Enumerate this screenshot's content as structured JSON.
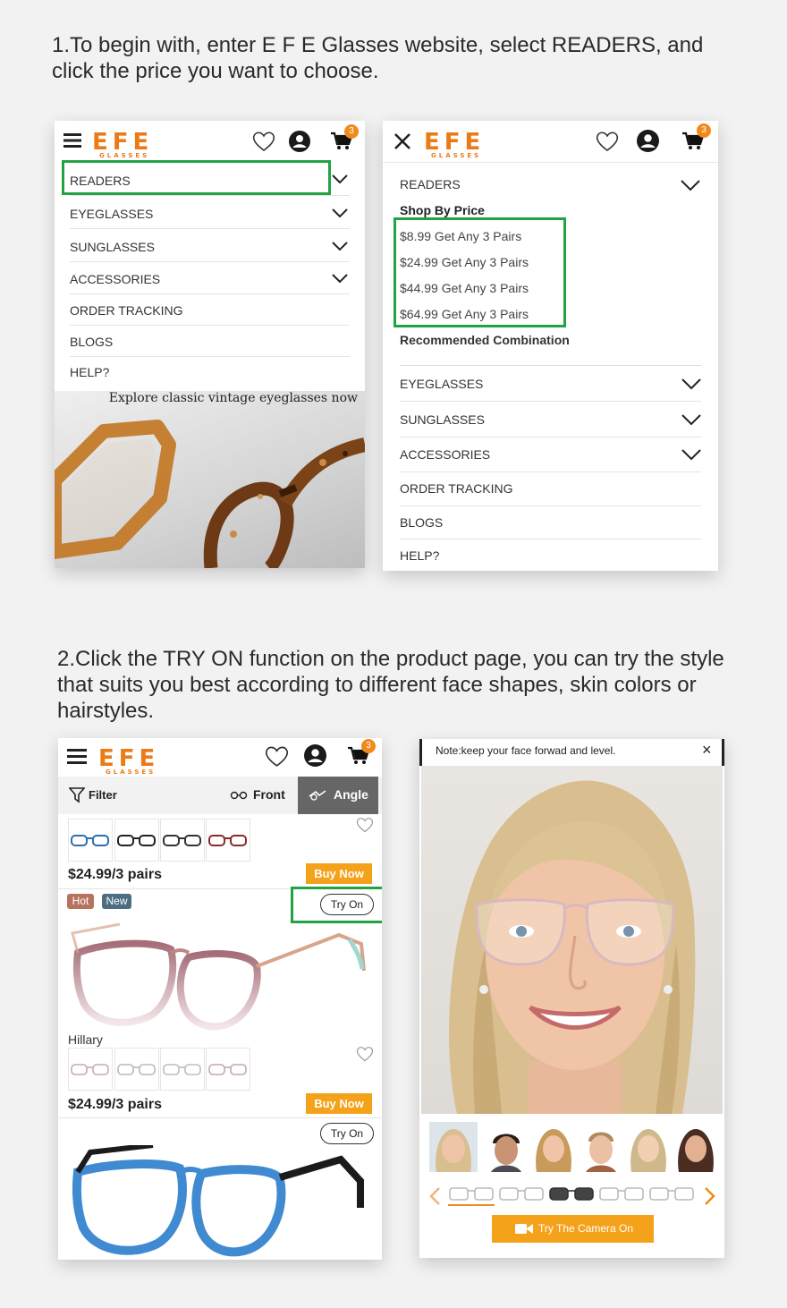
{
  "steps": {
    "step1": "1.To begin with, enter E F E Glasses website, select READERS, and\nclick the price you want to choose.",
    "step2": "2.Click the TRY ON function on the product page, you can try the style\nthat suits you best according to different face shapes, skin colors or\nhairstyles."
  },
  "brand": {
    "logo": "EFE",
    "tagline": "GLASSES",
    "accent": "#ec7a16",
    "highlight": "#22a342"
  },
  "cart_count": "3",
  "panel1": {
    "menu": [
      "READERS",
      "EYEGLASSES",
      "SUNGLASSES",
      "ACCESSORIES",
      "ORDER TRACKING",
      "BLOGS",
      "HELP?"
    ],
    "banner_text": "Explore classic vintage eyeglasses now"
  },
  "panel2": {
    "readers": "READERS",
    "shop_by_price": "Shop By Price",
    "prices": [
      "$8.99 Get Any 3 Pairs",
      "$24.99 Get Any 3 Pairs",
      "$44.99 Get Any 3 Pairs",
      "$64.99 Get Any 3 Pairs"
    ],
    "recommended": "Recommended Combination",
    "menu": [
      "EYEGLASSES",
      "SUNGLASSES",
      "ACCESSORIES",
      "ORDER TRACKING",
      "BLOGS",
      "HELP?"
    ]
  },
  "panel3": {
    "filter": "Filter",
    "front": "Front",
    "angle": "Angle",
    "products": [
      {
        "price": "$24.99/3 pairs",
        "buy": "Buy Now"
      },
      {
        "name": "Hillary",
        "tags": [
          "Hot",
          "New"
        ],
        "try_on": "Try On",
        "price": "$24.99/3 pairs",
        "buy": "Buy Now"
      },
      {
        "try_on": "Try On"
      }
    ]
  },
  "panel4": {
    "note": "Note:keep your face forwad and level.",
    "close": "×",
    "camera_button": "Try The Camera On"
  }
}
